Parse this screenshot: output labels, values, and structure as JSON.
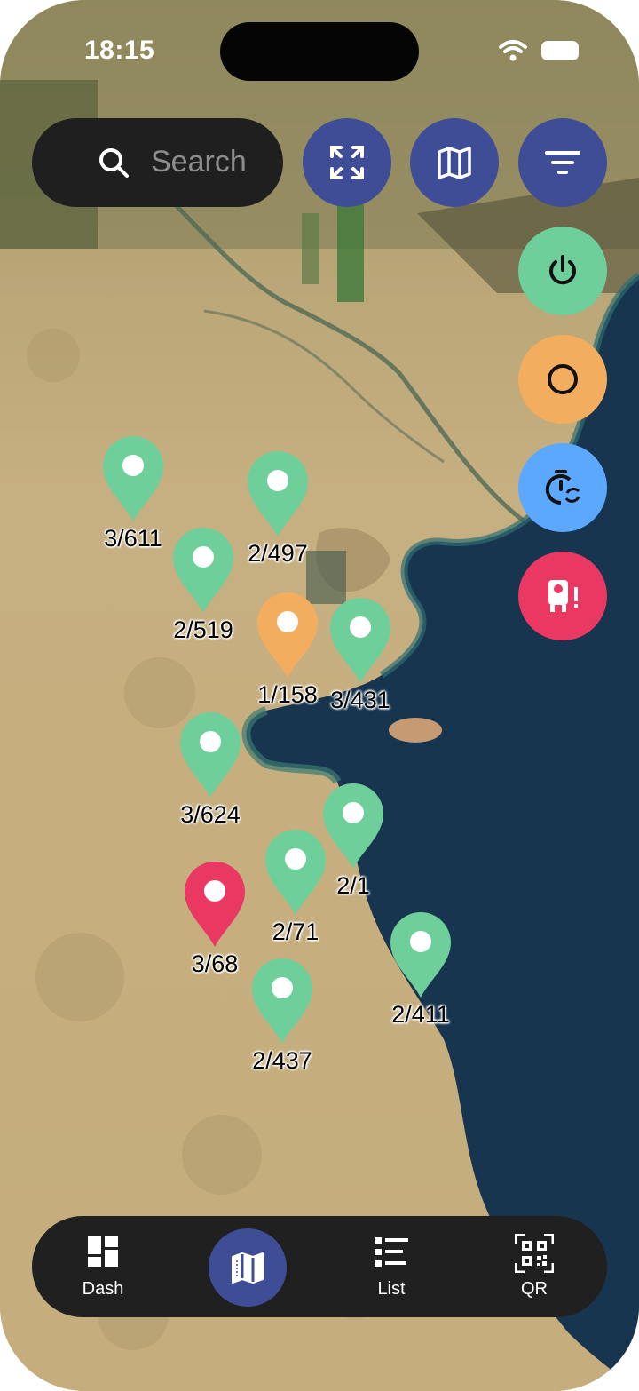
{
  "status_bar": {
    "time": "18:15"
  },
  "search": {
    "placeholder": "Search"
  },
  "colors": {
    "navy": "#3f4d97",
    "green": "#6fcf9a",
    "orange": "#f2ad5e",
    "blue": "#5da8ff",
    "red": "#e93862",
    "land": "#c4ac7e",
    "sea": "#16324a"
  },
  "toolbar": {
    "buttons": [
      {
        "icon": "fullscreen-icon"
      },
      {
        "icon": "map-icon"
      },
      {
        "icon": "filter-icon"
      }
    ]
  },
  "status_filters": [
    {
      "icon": "power-icon",
      "color": "green"
    },
    {
      "icon": "circle-outline-icon",
      "color": "orange"
    },
    {
      "icon": "timer-sync-icon",
      "color": "blue"
    },
    {
      "icon": "device-alert-icon",
      "color": "red"
    }
  ],
  "markers": [
    {
      "label": "3/611",
      "status": "green"
    },
    {
      "label": "2/497",
      "status": "green"
    },
    {
      "label": "2/519",
      "status": "green"
    },
    {
      "label": "1/158",
      "status": "orange"
    },
    {
      "label": "3/431",
      "status": "green"
    },
    {
      "label": "3/624",
      "status": "green"
    },
    {
      "label": "2/1",
      "status": "green"
    },
    {
      "label": "2/71",
      "status": "green"
    },
    {
      "label": "3/68",
      "status": "red"
    },
    {
      "label": "2/411",
      "status": "green"
    },
    {
      "label": "2/437",
      "status": "green"
    }
  ],
  "tabs": [
    {
      "label": "Dash",
      "icon": "dashboard-icon"
    },
    {
      "label": "",
      "icon": "map-icon",
      "active": true
    },
    {
      "label": "List",
      "icon": "list-icon"
    },
    {
      "label": "QR",
      "icon": "qr-code-icon"
    }
  ]
}
